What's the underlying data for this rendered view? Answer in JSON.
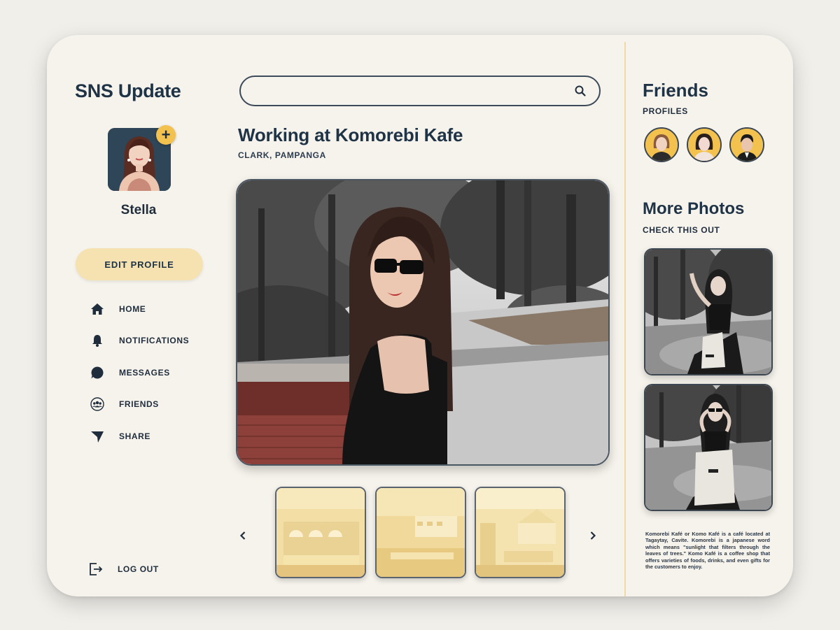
{
  "sidebar": {
    "brand": "SNS Update",
    "username": "Stella",
    "add_symbol": "+",
    "edit_profile_label": "EDIT PROFILE",
    "nav": [
      {
        "label": "HOME",
        "icon": "home-icon"
      },
      {
        "label": "NOTIFICATIONS",
        "icon": "bell-icon"
      },
      {
        "label": "MESSAGES",
        "icon": "message-bubble-icon"
      },
      {
        "label": "FRIENDS",
        "icon": "friends-group-icon"
      },
      {
        "label": "SHARE",
        "icon": "send-icon"
      }
    ],
    "logout_label": "LOG OUT",
    "logout_icon": "logout-icon"
  },
  "search": {
    "value": "",
    "placeholder": "",
    "icon": "search-icon"
  },
  "post": {
    "title": "Working at Komorebi Kafe",
    "location": "CLARK, PAMPANGA"
  },
  "gallery": {
    "prev_icon": "chevron-left-icon",
    "next_icon": "chevron-right-icon",
    "thumb_count": 3
  },
  "friends": {
    "title": "Friends",
    "subtitle": "PROFILES",
    "count": 3
  },
  "more_photos": {
    "title": "More Photos",
    "subtitle": "CHECK THIS OUT",
    "description": "Komorebi Kafé or Komo Kafé is a café located at Tagaytay, Cavite. Komorebi is a japanese word which means \"sunlight that filters through the leaves of trees.\" Komo Kafé is a coffee shop that offers varieties of foods, drinks, and even gifts for the customers to enjoy."
  },
  "colors": {
    "accent_yellow": "#f2c14e",
    "button_bg": "#f5e2b0",
    "text_dark": "#1f3347",
    "card_bg": "#f6f3ec"
  }
}
